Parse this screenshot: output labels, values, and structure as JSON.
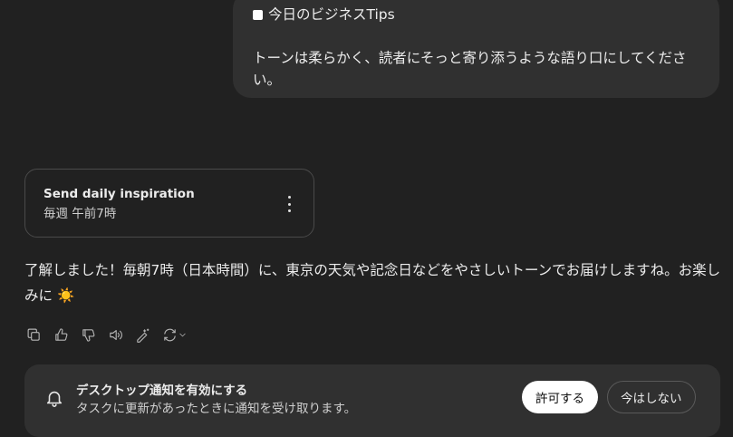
{
  "user_message": {
    "line1": "今日のビジネスTips",
    "line2": "トーンは柔らかく、読者にそっと寄り添うような語り口にしてください。"
  },
  "task_card": {
    "title": "Send daily inspiration",
    "schedule": "毎週 午前7時"
  },
  "assistant_message": {
    "text": "了解しました！毎朝7時（日本時間）に、東京の天気や記念日などをやさしいトーンでお届けしますね。お楽しみに",
    "emoji": "☀️"
  },
  "notification": {
    "title": "デスクトップ通知を有効にする",
    "subtitle": "タスクに更新があったときに通知を受け取ります。",
    "allow_label": "許可する",
    "later_label": "今はしない"
  }
}
